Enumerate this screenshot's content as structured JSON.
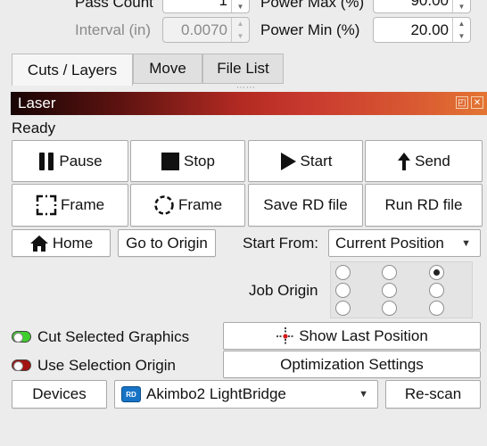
{
  "settings": {
    "pass_count_label": "Pass Count",
    "pass_count_value": "1",
    "power_max_label": "Power Max (%)",
    "power_max_value": "90.00",
    "interval_label": "Interval (in)",
    "interval_value": "0.0070",
    "power_min_label": "Power Min (%)",
    "power_min_value": "20.00"
  },
  "tabs": [
    {
      "label": "Cuts / Layers",
      "active": true
    },
    {
      "label": "Move",
      "active": false
    },
    {
      "label": "File List",
      "active": false
    }
  ],
  "laser": {
    "title": "Laser",
    "status": "Ready",
    "pause_label": "Pause",
    "stop_label": "Stop",
    "start_label": "Start",
    "send_label": "Send",
    "frame_label": "Frame",
    "frame_circle_label": "Frame",
    "save_rd_label": "Save RD file",
    "run_rd_label": "Run RD file",
    "home_label": "Home",
    "go_to_origin_label": "Go to Origin",
    "start_from_label": "Start From:",
    "start_from_value": "Current Position",
    "job_origin_label": "Job Origin",
    "job_origin_selected": "top-right",
    "cut_selected_label": "Cut Selected Graphics",
    "cut_selected_on": true,
    "use_selection_label": "Use Selection Origin",
    "use_selection_on": false,
    "show_last_label": "Show Last Position",
    "optimization_label": "Optimization Settings",
    "devices_label": "Devices",
    "device_value": "Akimbo2 LightBridge",
    "device_logo": "RD",
    "rescan_label": "Re-scan"
  },
  "colors": {
    "toggle_on": "#3fcf2c",
    "toggle_off": "#a3130f"
  }
}
